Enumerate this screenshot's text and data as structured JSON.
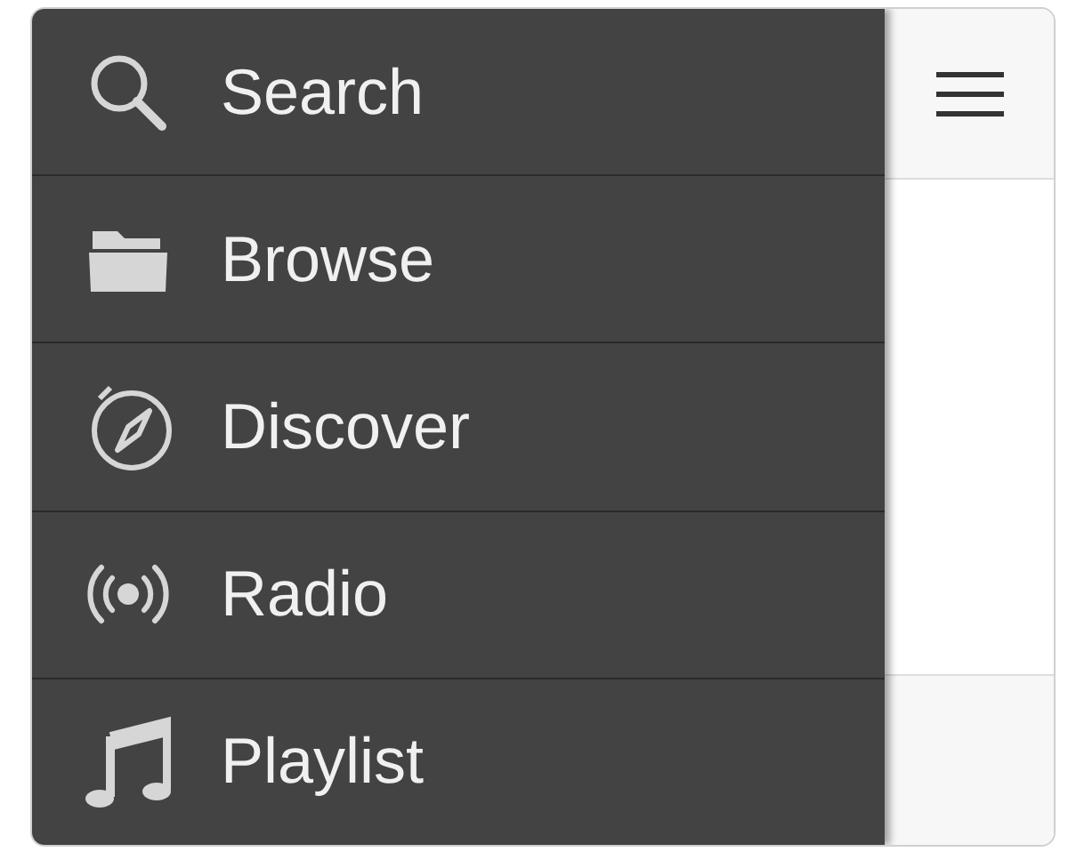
{
  "menu": {
    "items": [
      {
        "label": "Search"
      },
      {
        "label": "Browse"
      },
      {
        "label": "Discover"
      },
      {
        "label": "Radio"
      },
      {
        "label": "Playlist"
      }
    ]
  }
}
